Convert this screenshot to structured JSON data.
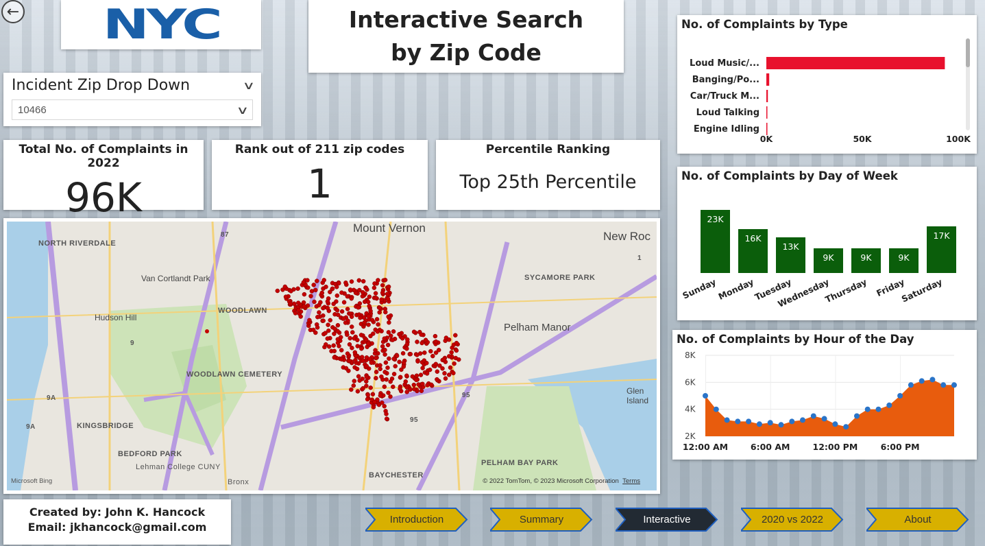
{
  "header": {
    "logo_text": "NYC",
    "title_line1": "Interactive Search",
    "title_line2": "by Zip Code"
  },
  "zip_filter": {
    "label": "Incident Zip Drop Down",
    "selected": "10466"
  },
  "kpis": [
    {
      "label": "Total No. of Complaints in 2022",
      "value": "96K"
    },
    {
      "label": "Rank out of 211 zip codes",
      "value": "1"
    },
    {
      "label": "Percentile Ranking",
      "value": "Top 25th Percentile"
    }
  ],
  "map": {
    "places": [
      "Mount Vernon",
      "New Roc",
      "Pelham Manor",
      "Van Cortlandt Park",
      "Hudson Hill",
      "Glen Island"
    ],
    "areas": [
      "NORTH RIVERDALE",
      "WOODLAWN",
      "WOODLAWN CEMETERY",
      "KINGSBRIDGE",
      "BEDFORD PARK",
      "SYCAMORE PARK",
      "PELHAM BAY PARK",
      "BAYCHESTER",
      "Lehman College CUNY",
      "Bronx"
    ],
    "highways": [
      "87",
      "95",
      "95",
      "9",
      "9A",
      "9A",
      "1"
    ],
    "attribution": "© 2022 TomTom, © 2023 Microsoft Corporation",
    "terms": "Terms",
    "provider": "Microsoft Bing",
    "colors": {
      "dots": "#c40000"
    }
  },
  "chart_data": [
    {
      "type": "bar",
      "orientation": "horizontal",
      "title": "No. of Complaints by Type",
      "categories": [
        "Loud Music/...",
        "Banging/Po...",
        "Car/Truck M...",
        "Loud Talking",
        "Engine Idling"
      ],
      "values": [
        93000,
        1500,
        800,
        500,
        400
      ],
      "xticks": [
        "0K",
        "50K",
        "100K"
      ],
      "xlim": [
        0,
        100000
      ],
      "color": "#e8112d"
    },
    {
      "type": "bar",
      "title": "No. of Complaints by Day of Week",
      "categories": [
        "Sunday",
        "Monday",
        "Tuesday",
        "Wednesday",
        "Thursday",
        "Friday",
        "Saturday"
      ],
      "values": [
        23,
        16,
        13,
        9,
        9,
        9,
        17
      ],
      "labels": [
        "23K",
        "16K",
        "13K",
        "9K",
        "9K",
        "9K",
        "17K"
      ],
      "color": "#0b5e0b"
    },
    {
      "type": "area",
      "title": "No. of Complaints by Hour of the Day",
      "x": [
        0,
        1,
        2,
        3,
        4,
        5,
        6,
        7,
        8,
        9,
        10,
        11,
        12,
        13,
        14,
        15,
        16,
        17,
        18,
        19,
        20,
        21,
        22,
        23
      ],
      "values": [
        5000,
        4000,
        3200,
        3100,
        3100,
        2900,
        3000,
        2850,
        3100,
        3200,
        3500,
        3300,
        2900,
        2700,
        3500,
        4000,
        4000,
        4300,
        5000,
        5800,
        6100,
        6200,
        5800,
        5800
      ],
      "yticks": [
        "2K",
        "4K",
        "6K",
        "8K"
      ],
      "ylim": [
        2000,
        8000
      ],
      "xticks": [
        "12:00 AM",
        "6:00 AM",
        "12:00 PM",
        "6:00 PM"
      ],
      "fill": "#e85c0d",
      "marker": "#2a74c8"
    }
  ],
  "credit": {
    "line1": "Created by: John K. Hancock",
    "line2": "Email: jkhancock@gmail.com"
  },
  "nav": [
    "Introduction",
    "Summary",
    "Interactive",
    "2020 vs 2022",
    "About"
  ],
  "nav_active": "Interactive",
  "colors": {
    "nav_fill": "#d8b000",
    "nav_active": "#222a33",
    "nav_border": "#1f5fbf"
  }
}
